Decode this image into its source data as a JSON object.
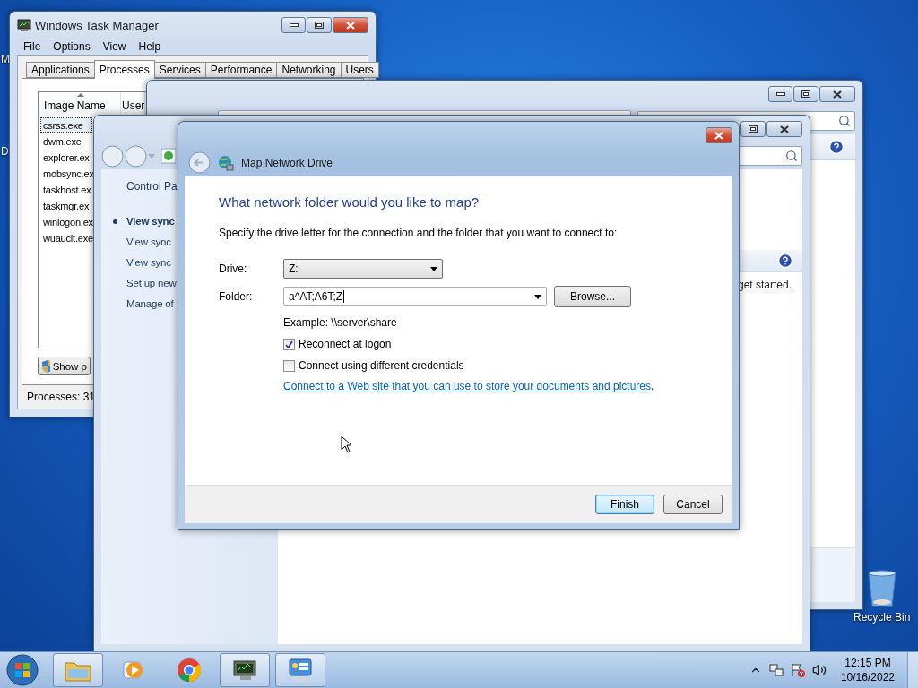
{
  "desktop": {
    "icons": [
      {
        "label": "M",
        "kind": "cut"
      },
      {
        "label": "D",
        "kind": "cut"
      },
      {
        "label": "Recycle Bin",
        "kind": "bin"
      }
    ]
  },
  "task_manager": {
    "title": "Windows Task Manager",
    "menu": [
      "File",
      "Options",
      "View",
      "Help"
    ],
    "tabs": [
      {
        "label": "Applications",
        "selected": false
      },
      {
        "label": "Processes",
        "selected": true
      },
      {
        "label": "Services",
        "selected": false
      },
      {
        "label": "Performance",
        "selected": false
      },
      {
        "label": "Networking",
        "selected": false
      },
      {
        "label": "Users",
        "selected": false
      }
    ],
    "columns": [
      "Image Name",
      "User"
    ],
    "rows": [
      {
        "name": "csrss.exe",
        "selected": true
      },
      {
        "name": "dwm.exe",
        "selected": false
      },
      {
        "name": "explorer.ex",
        "selected": false
      },
      {
        "name": "mobsync.ex",
        "selected": false
      },
      {
        "name": "taskhost.ex",
        "selected": false
      },
      {
        "name": "taskmgr.ex",
        "selected": false
      },
      {
        "name": "winlogon.ex",
        "selected": false
      },
      {
        "name": "wuauclt.exe",
        "selected": false
      }
    ],
    "button": "Show p",
    "status": "Processes: 31"
  },
  "sync_window": {
    "breadcrumb": "Control Pa",
    "tasks": [
      {
        "label": "View sync",
        "selected": true
      },
      {
        "label": "View sync",
        "selected": false
      },
      {
        "label": "View sync",
        "selected": false
      },
      {
        "label": "Set up new",
        "selected": false
      },
      {
        "label": "Manage of",
        "selected": false
      }
    ],
    "message": "get started."
  },
  "dialog": {
    "title": "Map Network Drive",
    "heading": "What network folder would you like to map?",
    "instruction": "Specify the drive letter for the connection and the folder that you want to connect to:",
    "fields": [
      {
        "label": "Drive:",
        "value": "Z:",
        "kind": "dropdown"
      },
      {
        "label": "Folder:",
        "value": "a^AT;A6T;Z",
        "kind": "combo"
      }
    ],
    "browse": "Browse...",
    "example": "Example: \\\\server\\share",
    "options": [
      {
        "label": "Reconnect at logon",
        "checked": true
      },
      {
        "label": "Connect using different credentials",
        "checked": false
      }
    ],
    "link": "Connect to a Web site that you can use to store your documents and pictures",
    "link_suffix": ".",
    "buttons": [
      {
        "label": "Finish",
        "default": true
      },
      {
        "label": "Cancel",
        "default": false
      }
    ]
  },
  "taskbar": {
    "items": [
      {
        "kind": "explorer",
        "running": true
      },
      {
        "kind": "media",
        "running": false
      },
      {
        "kind": "chrome",
        "running": false
      },
      {
        "kind": "taskmgr",
        "running": true
      },
      {
        "kind": "control",
        "running": true
      }
    ],
    "clock": {
      "time": "12:15 PM",
      "date": "10/16/2022"
    }
  }
}
